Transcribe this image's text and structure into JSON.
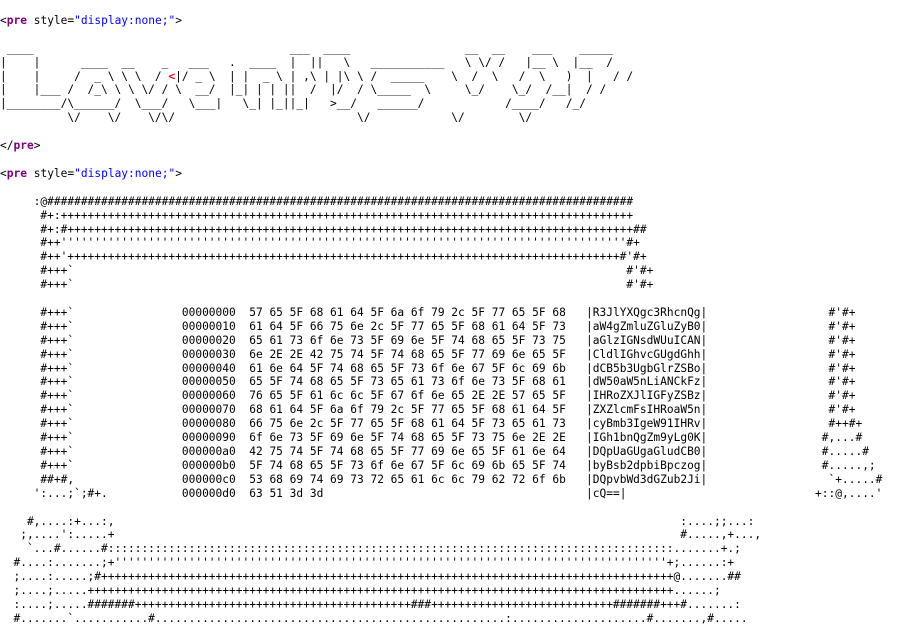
{
  "source": {
    "open_tag": {
      "lt": "<",
      "name": "pre",
      "attr": "style",
      "eq": "=",
      "value": "\"display:none;\"",
      "gt": ">"
    },
    "close_tag": {
      "lt": "</",
      "name": "pre",
      "gt": ">"
    },
    "banner_lines": [
      " ____                                      ___  ____                 __  __    ___    _____   ",
      "|    |      ____  __    _   ___   .  ____  |  ||   \\   ___________   \\ \\/ /   |__ \\  |__  /  ",
      "|    |     /  _ \\ \\ \\  /  |/ _ \\  | |  _ \\ | ,\\ | |\\ \\ /  _____    \\  /  \\   /  \\   )  |   / /   ",
      "|    |___ /  /_\\ \\ \\ \\/ / \\  __/  |_| | | ||  /  |/  / \\_____  \\     \\_/    \\_/  /__|  / /    ",
      "|________/\\______/  \\___/   \\___|   \\_| |_||_|   >__/   ______/            /____/   /_/     ",
      "          \\/    \\/    \\/\\/                           \\/            \\/        \\/          "
    ],
    "banner_red_mark": "<",
    "frame_top": [
      "     :@#######################################################################################",
      "      #+:+++++++++++++++++++++++++++++++++++++++++++++++++++++++++++++++++++++++++++++++++++++",
      "      #+:#++++++++++++++++++++++++++++++++++++++++++++++++++++++++++++++++++++++++++++++++++++##",
      "      #++''''''''''''''''''''''''''''''''''''''''''''''''''''''''''''''''''''''''''''''''''''#+",
      "      #++'++++++++++++++++++++++++++++++++++++++++++++++++++++++++++++++++++++++++++++++++++#'#+",
      "      #+++`                                                                                  #'#+",
      "      #+++`                                                                                  #'#+"
    ],
    "hexdump": [
      {
        "left": "      #+++`                ",
        "offset": "00000000",
        "bytes": "57 65 5F 68 61 64 5F 6a 6f 79 2c 5F 77 65 5F 68",
        "ascii": "|R3JlYXQgc3RhcnQg|",
        "right": "                  #'#+"
      },
      {
        "left": "      #+++`                ",
        "offset": "00000010",
        "bytes": "61 64 5F 66 75 6e 2c 5F 77 65 5F 68 61 64 5F 73",
        "ascii": "|aW4gZmluZGluZyB0|",
        "right": "                  #'#+"
      },
      {
        "left": "      #+++`                ",
        "offset": "00000020",
        "bytes": "65 61 73 6f 6e 73 5F 69 6e 5F 74 68 65 5F 73 75",
        "ascii": "|aGlzIGNsdWUuICAN|",
        "right": "                  #'#+"
      },
      {
        "left": "      #+++`                ",
        "offset": "00000030",
        "bytes": "6e 2E 2E 42 75 74 5F 74 68 65 5F 77 69 6e 65 5F",
        "ascii": "|CldlIGhvcGUgdGhh|",
        "right": "                  #'#+"
      },
      {
        "left": "      #+++`                ",
        "offset": "00000040",
        "bytes": "61 6e 64 5F 74 68 65 5F 73 6f 6e 67 5F 6c 69 6b",
        "ascii": "|dCB5b3UgbGlrZSBo|",
        "right": "                  #'#+"
      },
      {
        "left": "      #+++`                ",
        "offset": "00000050",
        "bytes": "65 5F 74 68 65 5F 73 65 61 73 6f 6e 73 5F 68 61",
        "ascii": "|dW50aW5nLiANCkFz|",
        "right": "                  #'#+"
      },
      {
        "left": "      #+++`                ",
        "offset": "00000060",
        "bytes": "76 65 5F 61 6c 6c 5F 67 6f 6e 65 2E 2E 57 65 5F",
        "ascii": "|IHRoZXJlIGFyZSBz|",
        "right": "                  #'#+"
      },
      {
        "left": "      #+++`                ",
        "offset": "00000070",
        "bytes": "68 61 64 5F 6a 6f 79 2c 5F 77 65 5F 68 61 64 5F",
        "ascii": "|ZXZlcmFsIHRoaW5n|",
        "right": "                  #'#+"
      },
      {
        "left": "      #+++`                ",
        "offset": "00000080",
        "bytes": "66 75 6e 2c 5F 77 65 5F 68 61 64 5F 73 65 61 73",
        "ascii": "|cyBmb3IgeW91IHRv|",
        "right": "                  #++#+"
      },
      {
        "left": "      #+++`                ",
        "offset": "00000090",
        "bytes": "6f 6e 73 5F 69 6e 5F 74 68 65 5F 73 75 6e 2E 2E",
        "ascii": "|IGh1bnQgZm9yLg0K|",
        "right": "                 #,...#"
      },
      {
        "left": "      #+++`                ",
        "offset": "000000a0",
        "bytes": "42 75 74 5F 74 68 65 5F 77 69 6e 65 5F 61 6e 64",
        "ascii": "|DQpUaGUgaGludCB0|",
        "right": "                 #.....#"
      },
      {
        "left": "      #+++`                ",
        "offset": "000000b0",
        "bytes": "5F 74 68 65 5F 73 6f 6e 67 5F 6c 69 6b 65 5F 74",
        "ascii": "|byBsb2dpbiBpczog|",
        "right": "                 #.....,;"
      },
      {
        "left": "      ##+#,                ",
        "offset": "000000c0",
        "bytes": "53 68 69 74 69 73 72 65 61 6c 6c 79 62 72 6f 6b",
        "ascii": "|DQpvbWd3dGZub2Ji|",
        "right": "                  `+.....#"
      },
      {
        "left": "     ':...;`;#+.           ",
        "offset": "000000d0",
        "bytes": "63 51 3d 3d                                    ",
        "ascii": "|cQ==|           ",
        "right": "                 +::@,....'"
      }
    ],
    "frame_bottom": [
      "    #,....:+...:,                                                                                    :....;;...:",
      "   ;,....':.....+                                                                                    #.....,+...,",
      "    `...#......#::::::::::::::::::::::::::::::::::::::::::::::::::::::::::::::::::::::::::::::::::::.......+.;",
      "  #....:.......;+''''''''''''''''''''''''''''''''''''''''''''''''''''''''''''''''''''''''''''''''''+;......:+",
      "  ;....:.....;#+++++++++++++++++++++++++++++++++++++++++++++++++++++++++++++++++++++++++++++++++++++@.......##",
      "  ;....;.....+++++++++++++++++++++++++++++++++++++++++++++++++++++++++++++++++++++++++++++++++++++++......;",
      "  :....;.....#######+++++++++++++++++++++++++++++++++++++++++###+++++++++++++++++++++++++++#######+++#.......:",
      "  #.......`...........#....................................................:....................#.......,#....."
    ]
  }
}
